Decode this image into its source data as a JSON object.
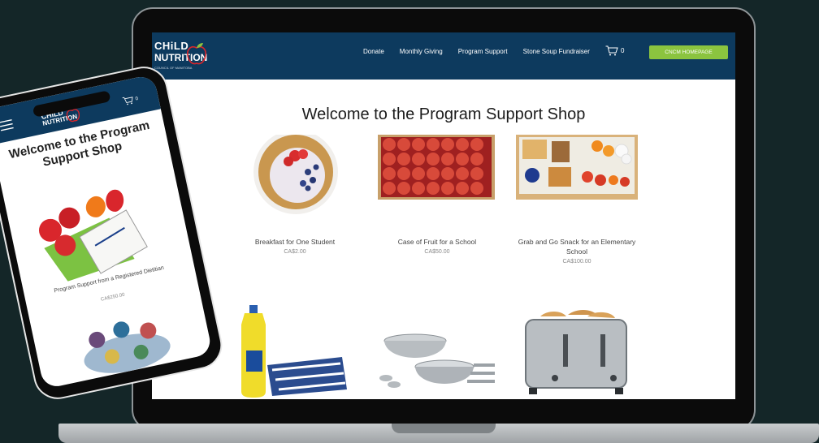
{
  "site": {
    "logo": {
      "line1": "CHiLD",
      "line2": "NUTRITION",
      "line3": "COUNCIL OF MANITOBA"
    },
    "nav_links": [
      "Donate",
      "Monthly Giving",
      "Program Support",
      "Stone Soup Fundraiser"
    ],
    "cart_count": "0",
    "homepage_button": "CNCM HOMEPAGE",
    "page_title": "Welcome to the Program Support Shop"
  },
  "products": [
    {
      "name": "Breakfast for One Student",
      "price": "CA$2.00"
    },
    {
      "name": "Case of Fruit for a School",
      "price": "CA$50.00"
    },
    {
      "name": "Grab and Go Snack for an Elementary School",
      "price": "CA$100.00"
    }
  ],
  "phone": {
    "cart_count": "0",
    "page_title": "Welcome to the Program Support Shop",
    "product_name": "Program Support from a Registered Dietitian",
    "product_price": "CA$250.00"
  },
  "colors": {
    "nav": "#0d3a5e",
    "button": "#8bc43f",
    "background": "#142628",
    "apple": "#d9262c",
    "leaf": "#8bc43f"
  }
}
